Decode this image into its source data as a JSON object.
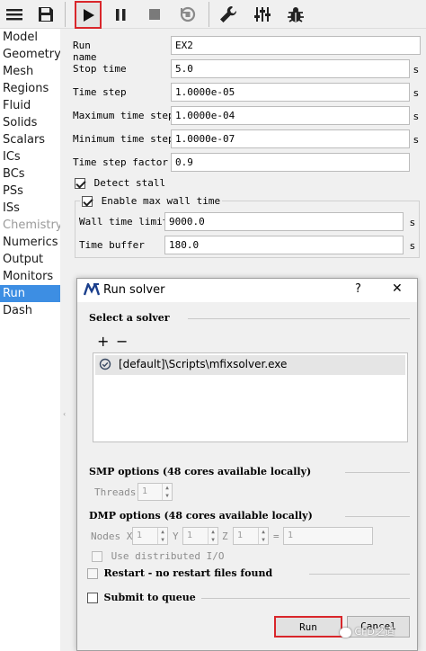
{
  "toolbar": {
    "items": [
      "menu-icon",
      "save-icon",
      "play-icon",
      "pause-icon",
      "stop-icon",
      "reset-icon",
      "wrench-icon",
      "sliders-icon",
      "bug-icon"
    ]
  },
  "sidebar": {
    "items": [
      {
        "label": "Model",
        "state": "normal"
      },
      {
        "label": "Geometry",
        "state": "normal"
      },
      {
        "label": "Mesh",
        "state": "normal"
      },
      {
        "label": "Regions",
        "state": "normal"
      },
      {
        "label": "Fluid",
        "state": "normal"
      },
      {
        "label": "Solids",
        "state": "normal"
      },
      {
        "label": "Scalars",
        "state": "normal"
      },
      {
        "label": "ICs",
        "state": "normal"
      },
      {
        "label": "BCs",
        "state": "normal"
      },
      {
        "label": "PSs",
        "state": "normal"
      },
      {
        "label": "ISs",
        "state": "normal"
      },
      {
        "label": "Chemistry",
        "state": "disabled"
      },
      {
        "label": "Numerics",
        "state": "normal"
      },
      {
        "label": "Output",
        "state": "normal"
      },
      {
        "label": "Monitors",
        "state": "normal"
      },
      {
        "label": "Run",
        "state": "selected"
      },
      {
        "label": "Dash",
        "state": "normal"
      }
    ]
  },
  "run": {
    "run_name_label": "Run name",
    "run_name": "EX2",
    "stop_time_label": "Stop time",
    "stop_time": "5.0",
    "stop_time_unit": "s",
    "time_step_label": "Time step",
    "time_step": "1.0000e-05",
    "time_step_unit": "s",
    "max_time_step_label": "Maximum time step",
    "max_time_step": "1.0000e-04",
    "max_time_step_unit": "s",
    "min_time_step_label": "Minimum time step",
    "min_time_step": "1.0000e-07",
    "min_time_step_unit": "s",
    "time_step_factor_label": "Time step factor",
    "time_step_factor": "0.9",
    "detect_stall_label": "Detect stall",
    "enable_wall_label": "Enable max wall time",
    "wall_time_limit_label": "Wall time limit",
    "wall_time_limit": "9000.0",
    "wall_time_limit_unit": "s",
    "time_buffer_label": "Time buffer",
    "time_buffer": "180.0",
    "time_buffer_unit": "s"
  },
  "dialog": {
    "title": "Run solver",
    "help": "?",
    "close": "✕",
    "select_solver_label": "Select a solver",
    "add": "+",
    "remove": "−",
    "solver_item": "[default]\\Scripts\\mfixsolver.exe",
    "smp_label": "SMP options (48 cores available locally)",
    "threads_label": "Threads",
    "threads_value": "1",
    "dmp_label": "DMP options (48 cores available locally)",
    "nodes_x_label": "Nodes X",
    "nodes_x": "1",
    "y_label": "Y",
    "nodes_y": "1",
    "z_label": "Z",
    "nodes_z": "1",
    "eq_label": "=",
    "nodes_total": "1",
    "distributed_io_label": "Use distributed I/O",
    "restart_label": "Restart - no restart files found",
    "submit_label": "Submit to queue",
    "run_button": "Run",
    "cancel_button": "Cancel"
  },
  "watermark": "CFD之道"
}
